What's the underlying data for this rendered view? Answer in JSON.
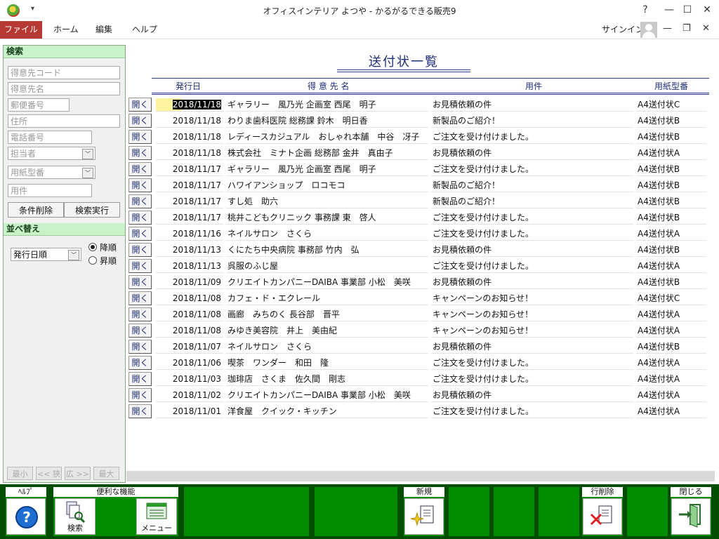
{
  "window": {
    "title": "オフィスインテリア よつや - かるがるできる販売9",
    "qa_arrow": "▾",
    "help": "?",
    "minimize": "—",
    "maximize": "☐",
    "close": "✕"
  },
  "menu": {
    "file": "ファイル",
    "home": "ホーム",
    "edit": "編集",
    "help": "ヘルプ",
    "signin": "サインイン",
    "min": "—",
    "restore": "❐",
    "close": "✕"
  },
  "search": {
    "header": "検索",
    "customer_code": "得意先コード",
    "customer_name": "得意先名",
    "postal": "郵便番号",
    "address": "住所",
    "phone": "電話番号",
    "staff": "担当者",
    "paper_type": "用紙型番",
    "subject": "用件",
    "clear_button": "条件削除",
    "run_button": "検索実行"
  },
  "sort": {
    "header": "並べ替え",
    "field": "発行日順",
    "desc": "降順",
    "asc": "昇順"
  },
  "nav": {
    "smallest": "最小",
    "narrow": "<< 狭",
    "wide": "広 >>",
    "largest": "最大"
  },
  "report": {
    "title": "送付状一覧",
    "columns": {
      "date": "発行日",
      "customer": "得 意 先 名",
      "subject": "用件",
      "paper": "用紙型番"
    },
    "open_label": "開く",
    "rows": [
      {
        "date": "2018/11/18",
        "customer": "ギャラリー　風乃光 企画室 西尾　明子",
        "subject": "お見積依頼の件",
        "paper": "A4送付状C"
      },
      {
        "date": "2018/11/18",
        "customer": "わりま歯科医院 総務課 鈴木　明日香",
        "subject": "新製品のご紹介！",
        "paper": "A4送付状B"
      },
      {
        "date": "2018/11/18",
        "customer": "レディースカジュアル　おしゃれ本舗　中谷　冴子",
        "subject": "ご注文を受け付けました。",
        "paper": "A4送付状B"
      },
      {
        "date": "2018/11/18",
        "customer": "株式会社　ミナト企画 総務部 金井　真由子",
        "subject": "お見積依頼の件",
        "paper": "A4送付状A"
      },
      {
        "date": "2018/11/17",
        "customer": "ギャラリー　風乃光 企画室 西尾　明子",
        "subject": "ご注文を受け付けました。",
        "paper": "A4送付状B"
      },
      {
        "date": "2018/11/17",
        "customer": "ハワイアンショップ　ロコモコ",
        "subject": "新製品のご紹介！",
        "paper": "A4送付状B"
      },
      {
        "date": "2018/11/17",
        "customer": "すし処　助六",
        "subject": "新製品のご紹介！",
        "paper": "A4送付状B"
      },
      {
        "date": "2018/11/17",
        "customer": "桃井こどもクリニック 事務課 東　啓人",
        "subject": "ご注文を受け付けました。",
        "paper": "A4送付状B"
      },
      {
        "date": "2018/11/16",
        "customer": "ネイルサロン　さくら",
        "subject": "ご注文を受け付けました。",
        "paper": "A4送付状A"
      },
      {
        "date": "2018/11/13",
        "customer": "くにたち中央病院 事務部 竹内　弘",
        "subject": "お見積依頼の件",
        "paper": "A4送付状B"
      },
      {
        "date": "2018/11/13",
        "customer": "呉服のふじ屋",
        "subject": "ご注文を受け付けました。",
        "paper": "A4送付状A"
      },
      {
        "date": "2018/11/09",
        "customer": "クリエイトカンパニーDAIBA 事業部 小松　美咲",
        "subject": "お見積依頼の件",
        "paper": "A4送付状B"
      },
      {
        "date": "2018/11/08",
        "customer": "カフェ・ド・エクレール",
        "subject": "キャンペーンのお知らせ！",
        "paper": "A4送付状C"
      },
      {
        "date": "2018/11/08",
        "customer": "画廊　みちのく 長谷部　晋平",
        "subject": "キャンペーンのお知らせ！",
        "paper": "A4送付状A"
      },
      {
        "date": "2018/11/08",
        "customer": "みゆき美容院　井上　美由紀",
        "subject": "キャンペーンのお知らせ！",
        "paper": "A4送付状A"
      },
      {
        "date": "2018/11/07",
        "customer": "ネイルサロン　さくら",
        "subject": "お見積依頼の件",
        "paper": "A4送付状B"
      },
      {
        "date": "2018/11/06",
        "customer": "喫茶　ワンダー　和田　隆",
        "subject": "ご注文を受け付けました。",
        "paper": "A4送付状A"
      },
      {
        "date": "2018/11/03",
        "customer": "珈琲店　さくま　佐久間　剛志",
        "subject": "ご注文を受け付けました。",
        "paper": "A4送付状A"
      },
      {
        "date": "2018/11/02",
        "customer": "クリエイトカンパニーDAIBA 事業部 小松　美咲",
        "subject": "お見積依頼の件",
        "paper": "A4送付状A"
      },
      {
        "date": "2018/11/01",
        "customer": "洋食屋　クイック・キッチン",
        "subject": "ご注文を受け付けました。",
        "paper": "A4送付状A"
      }
    ]
  },
  "footer": {
    "help": "ﾍﾙﾌﾟ",
    "useful": "便利な機能",
    "search": "検索",
    "menu": "メニュー",
    "new": "新規",
    "delete_row": "行削除",
    "close": "閉じる"
  }
}
